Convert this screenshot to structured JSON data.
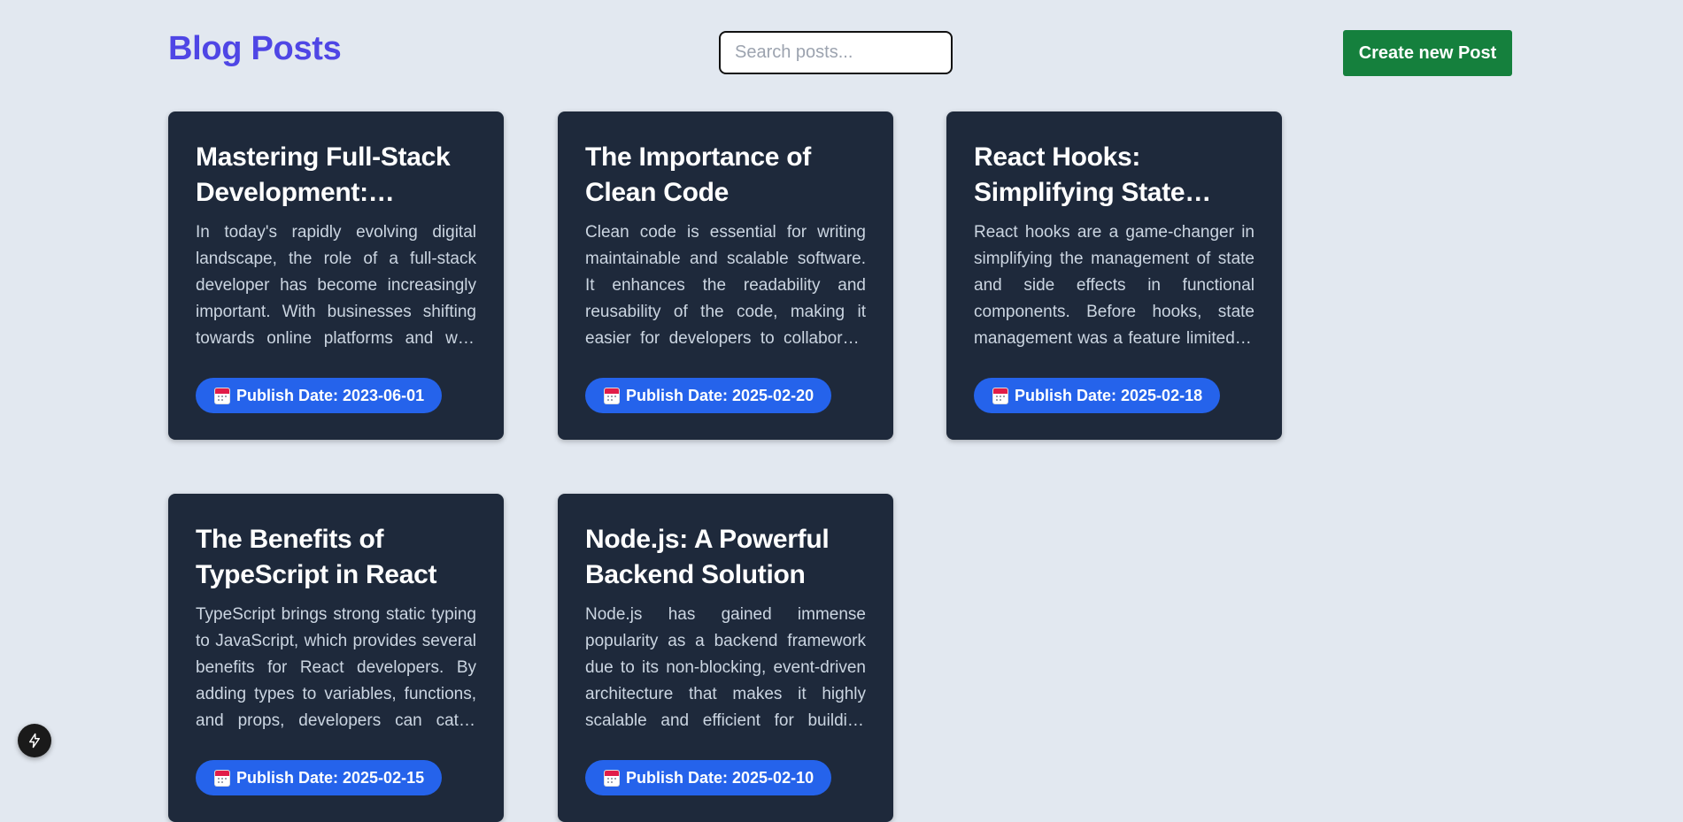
{
  "header": {
    "title": "Blog Posts",
    "search_placeholder": "Search posts...",
    "create_button_label": "Create new Post"
  },
  "posts": [
    {
      "title": "Mastering Full-Stack Development: Essentials for Modern Developers",
      "excerpt": "In today's rapidly evolving digital landscape, the role of a full-stack developer has become increasingly important. With businesses shifting towards online platforms and web applications",
      "publish_date": "Publish Date: 2023-06-01"
    },
    {
      "title": "The Importance of Clean Code",
      "excerpt": "Clean code is essential for writing maintainable and scalable software. It enhances the readability and reusability of the code, making it easier for developers to collaborate and maintain",
      "publish_date": "Publish Date: 2025-02-20"
    },
    {
      "title": "React Hooks: Simplifying State Management",
      "excerpt": "React hooks are a game-changer in simplifying the management of state and side effects in functional components. Before hooks, state management was a feature limited to class components",
      "publish_date": "Publish Date: 2025-02-18"
    },
    {
      "title": "The Benefits of TypeScript in React",
      "excerpt": "TypeScript brings strong static typing to JavaScript, which provides several benefits for React developers. By adding types to variables, functions, and props, developers can catch errors",
      "publish_date": "Publish Date: 2025-02-15"
    },
    {
      "title": "Node.js: A Powerful Backend Solution",
      "excerpt": "Node.js has gained immense popularity as a backend framework due to its non-blocking, event-driven architecture that makes it highly scalable and efficient for building network applications",
      "publish_date": "Publish Date: 2025-02-10"
    }
  ],
  "icons": {
    "date_badge_icon": "calendar-icon",
    "dev_tools_icon": "lightning-icon"
  },
  "colors": {
    "background": "#e2e8f0",
    "title": "#4f46e5",
    "card": "#1e293b",
    "create_button": "#15803d",
    "badge": "#2563eb"
  }
}
